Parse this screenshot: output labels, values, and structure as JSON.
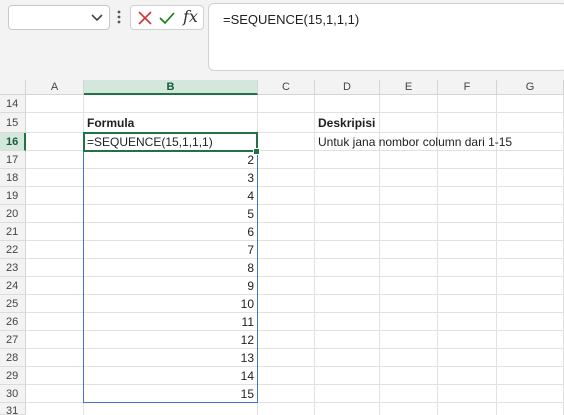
{
  "name_box": {
    "value": ""
  },
  "formula_bar": {
    "fx_label": "fx",
    "formula": "=SEQUENCE(15,1,1,1)",
    "cancel_icon": "x-icon",
    "enter_icon": "check-icon"
  },
  "columns": [
    "A",
    "B",
    "C",
    "D",
    "E",
    "F",
    "G"
  ],
  "rows": [
    "14",
    "15",
    "16",
    "17",
    "18",
    "19",
    "20",
    "21",
    "22",
    "23",
    "24",
    "25",
    "26",
    "27",
    "28",
    "29",
    "30",
    "31"
  ],
  "cells": {
    "B15": "Formula",
    "D15": "Deskripisi",
    "B16": "=SEQUENCE(15,1,1,1)",
    "D16": "Untuk jana nombor column dari 1-15"
  },
  "sequence_values": [
    "2",
    "3",
    "4",
    "5",
    "6",
    "7",
    "8",
    "9",
    "10",
    "11",
    "12",
    "13",
    "14",
    "15"
  ],
  "colors": {
    "accent": "#217346",
    "spill_border": "#4472c4"
  }
}
